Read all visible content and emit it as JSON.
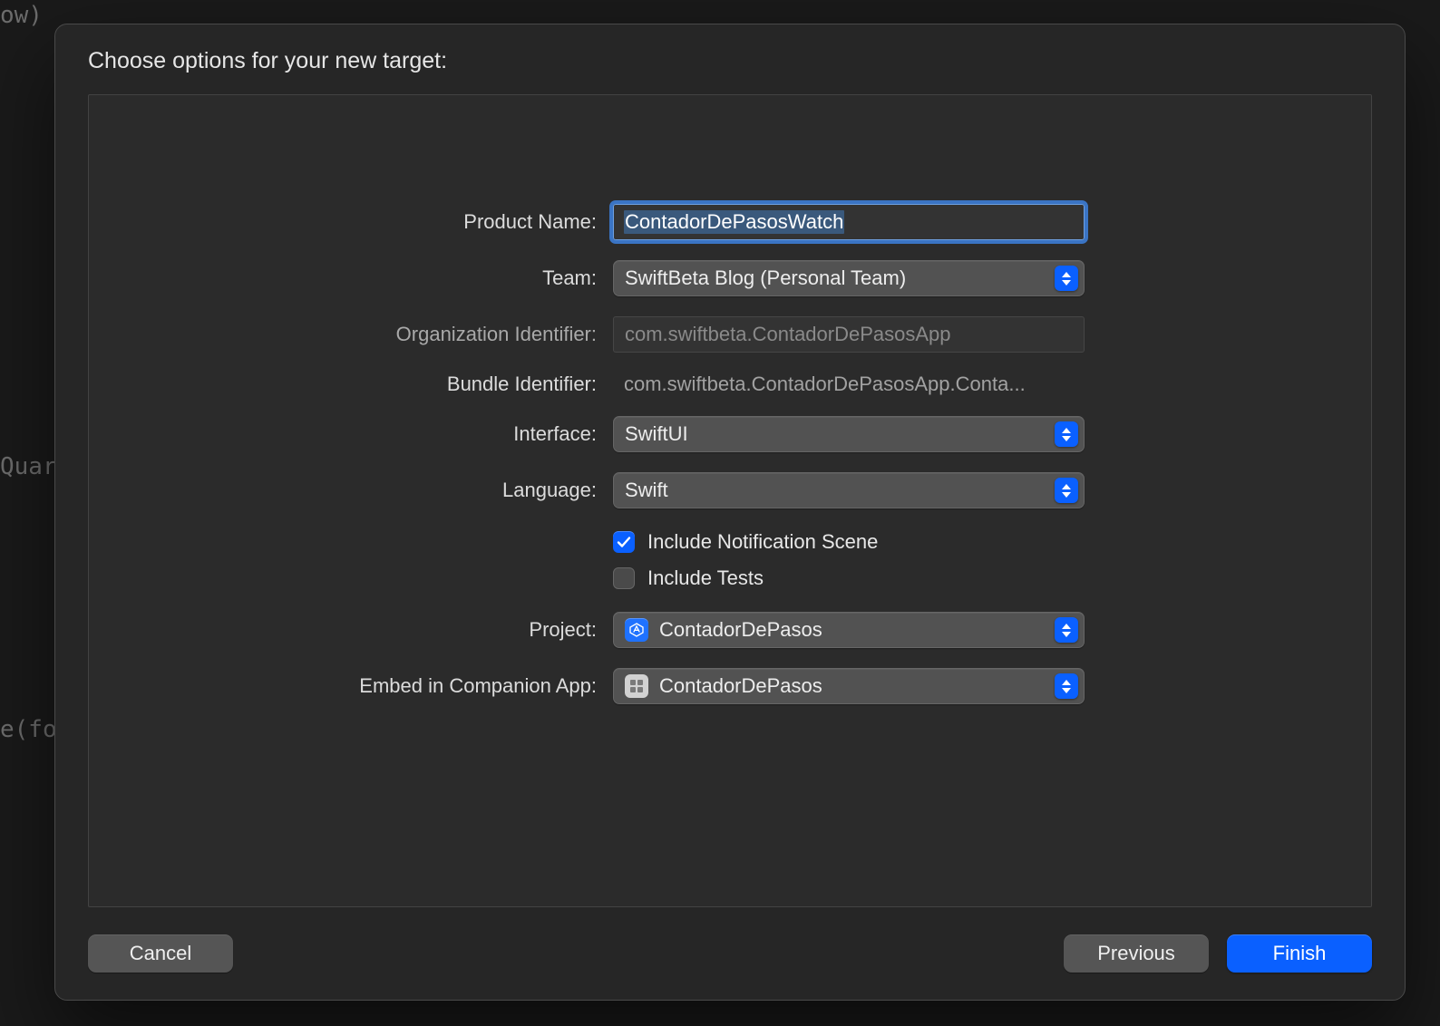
{
  "background_fragments": {
    "line1": "ow)",
    "line2": "Quar",
    "line3": "e(fo"
  },
  "sheet": {
    "title": "Choose options for your new target:"
  },
  "form": {
    "product_name": {
      "label": "Product Name:",
      "value": "ContadorDePasosWatch"
    },
    "team": {
      "label": "Team:",
      "value": "SwiftBeta Blog (Personal Team)"
    },
    "org_id": {
      "label": "Organization Identifier:",
      "value": "com.swiftbeta.ContadorDePasosApp"
    },
    "bundle_id": {
      "label": "Bundle Identifier:",
      "value": "com.swiftbeta.ContadorDePasosApp.Conta..."
    },
    "interface": {
      "label": "Interface:",
      "value": "SwiftUI"
    },
    "language": {
      "label": "Language:",
      "value": "Swift"
    },
    "notification_scene": {
      "label": "Include Notification Scene",
      "checked": true
    },
    "include_tests": {
      "label": "Include Tests",
      "checked": false
    },
    "project": {
      "label": "Project:",
      "value": "ContadorDePasos"
    },
    "embed": {
      "label": "Embed in Companion App:",
      "value": "ContadorDePasos"
    }
  },
  "buttons": {
    "cancel": "Cancel",
    "previous": "Previous",
    "finish": "Finish"
  }
}
